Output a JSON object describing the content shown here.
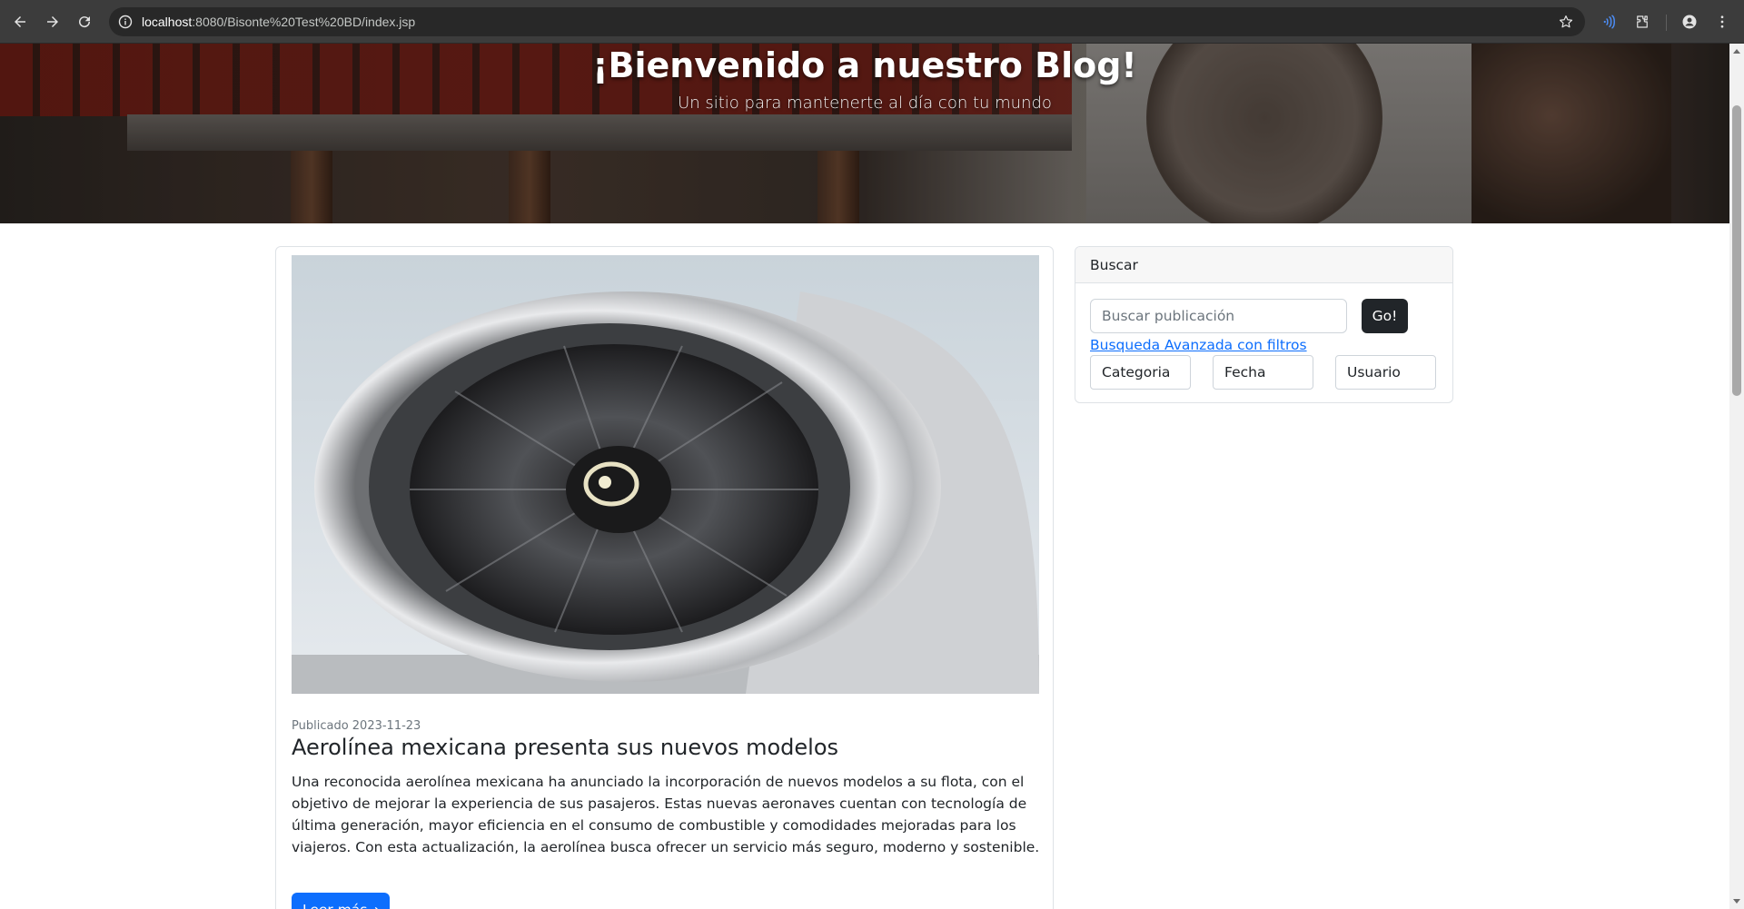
{
  "browser": {
    "url_host": "localhost",
    "url_path": ":8080/Bisonte%20Test%20BD/index.jsp",
    "icons": [
      "back-icon",
      "forward-icon",
      "reload-icon",
      "site-info-icon",
      "bookmark-star-icon",
      "media-cast-icon",
      "extensions-icon",
      "profile-icon",
      "menu-icon"
    ]
  },
  "hero": {
    "title": "¡Bienvenido a nuestro Blog!",
    "subtitle": "Un sitio para mantenerte al día con tu mundo"
  },
  "post": {
    "date_label": "Publicado 2023-11-23",
    "title": "Aerolínea mexicana presenta sus nuevos modelos",
    "body": "Una reconocida aerolínea mexicana ha anunciado la incorporación de nuevos modelos a su flota, con el objetivo de mejorar la experiencia de sus pasajeros. Estas nuevas aeronaves cuentan con tecnología de última generación, mayor eficiencia en el consumo de combustible y comodidades mejoradas para los viajeros. Con esta actualización, la aerolínea busca ofrecer un servicio más seguro, moderno y sostenible.",
    "read_more": "Leer más→"
  },
  "search": {
    "header": "Buscar",
    "placeholder": "Buscar publicación",
    "button": "Go!",
    "advanced_link": "Busqueda Avanzada con filtros",
    "filters": [
      "Categoria",
      "Fecha",
      "Usuario"
    ]
  },
  "colors": {
    "primary": "#0d6efd",
    "dark": "#212529",
    "chrome": "#3c3c3c"
  }
}
